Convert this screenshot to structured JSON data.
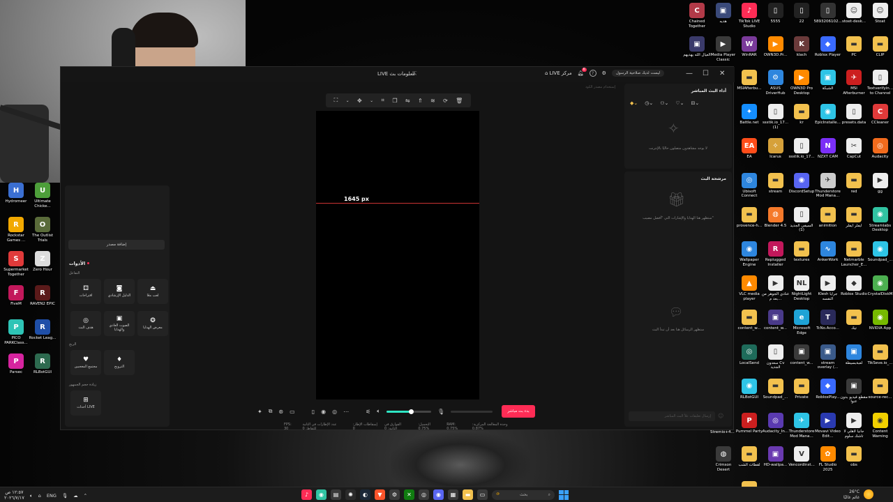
{
  "desktop_left_icons": [
    {
      "label": "Hydromeer",
      "color": "#3b6fd1",
      "glyph": "H"
    },
    {
      "label": "Ultimate Chicke...",
      "color": "#4d9e3a",
      "glyph": "U"
    },
    {
      "label": "Rockstar Games ...",
      "color": "#f2a900",
      "glyph": "R"
    },
    {
      "label": "The Outlist Trials",
      "color": "#5a6b3a",
      "glyph": "O"
    },
    {
      "label": "Supermarket Together",
      "color": "#e03a3a",
      "glyph": "S"
    },
    {
      "label": "Zero Hour",
      "color": "#dddddd",
      "glyph": "Z"
    },
    {
      "label": "FiveM",
      "color": "#c2185b",
      "glyph": "F"
    },
    {
      "label": "RAVEN2 EPIC",
      "color": "#5a1a1a",
      "glyph": "R"
    },
    {
      "label": "PICO PARKClass...",
      "color": "#2ec4b6",
      "glyph": "P"
    },
    {
      "label": "Rocket Leag...",
      "color": "#1f4fa8",
      "glyph": "R"
    },
    {
      "label": "Parsec",
      "color": "#d6249f",
      "glyph": "P"
    },
    {
      "label": "RLBotGUI",
      "color": "#2d6a4f",
      "glyph": "R"
    }
  ],
  "desktop_right_icons": [
    {
      "label": "Chained Together",
      "color": "#b23a48",
      "glyph": "C"
    },
    {
      "label": "هديه",
      "color": "#3a4a7a",
      "glyph": "▣"
    },
    {
      "label": "TikTok LIVE Studio",
      "color": "#fe2c55",
      "glyph": "♪"
    },
    {
      "label": "5555",
      "color": "#222222",
      "glyph": "▯"
    },
    {
      "label": "22",
      "color": "#222222",
      "glyph": "▯"
    },
    {
      "label": "5893206102...",
      "color": "#333333",
      "glyph": "▯"
    },
    {
      "label": "stoet-desk...",
      "color": "#eeeeee",
      "glyph": "☺"
    },
    {
      "label": "Stoat",
      "color": "#eeeeee",
      "glyph": "☺"
    },
    {
      "label": "العيال الله يهديهم",
      "color": "#3a3a6a",
      "glyph": "▣"
    },
    {
      "label": "Media Player Classic",
      "color": "#3a3a3a",
      "glyph": "▶"
    },
    {
      "label": "WinRAR",
      "color": "#7a3a9a",
      "glyph": "W"
    },
    {
      "label": "OWN3D.Pr...",
      "color": "#ff8a00",
      "glyph": "▶"
    },
    {
      "label": "klach",
      "color": "#6a3a3a",
      "glyph": "K"
    },
    {
      "label": "Roblox Player",
      "color": "#3a6aff",
      "glyph": "◆"
    },
    {
      "label": "PC",
      "color": "#f2c14e",
      "glyph": "▬"
    },
    {
      "label": "CLIP",
      "color": "#f2c14e",
      "glyph": "▬"
    },
    {
      "label": "MSIAfterbu...",
      "color": "#f2c14e",
      "glyph": "▬"
    },
    {
      "label": "ASUS DriverHub",
      "color": "#2e86de",
      "glyph": "⚙"
    },
    {
      "label": "OWN3D Pro Desktop",
      "color": "#ff8a00",
      "glyph": "▶"
    },
    {
      "label": "الشبكة",
      "color": "#2ec4e6",
      "glyph": "▣"
    },
    {
      "label": "MSI Afterburner",
      "color": "#cc1f1f",
      "glyph": "✈"
    },
    {
      "label": "Textverifyin... to Channel",
      "color": "#eeeeee",
      "glyph": "▯"
    },
    {
      "label": "Battle.net",
      "color": "#148eff",
      "glyph": "✦"
    },
    {
      "label": "ssstik.io_17... (1)",
      "color": "#eeeeee",
      "glyph": "▯"
    },
    {
      "label": "kr",
      "color": "#f2c14e",
      "glyph": "▬"
    },
    {
      "label": "EpicInstalle...",
      "color": "#2ec4e6",
      "glyph": "◉"
    },
    {
      "label": "presets.data",
      "color": "#eeeeee",
      "glyph": "▯"
    },
    {
      "label": "CCleaner",
      "color": "#e03a3a",
      "glyph": "C"
    },
    {
      "label": "EA",
      "color": "#ff4d1a",
      "glyph": "EA"
    },
    {
      "label": "Icarus",
      "color": "#d6a13a",
      "glyph": "✧"
    },
    {
      "label": "ssstik.io_17...",
      "color": "#eeeeee",
      "glyph": "▯"
    },
    {
      "label": "NZXT CAM",
      "color": "#7b2ff7",
      "glyph": "N"
    },
    {
      "label": "CapCut",
      "color": "#eeeeee",
      "glyph": "✂"
    },
    {
      "label": "Audacity",
      "color": "#f26b1d",
      "glyph": "◎"
    },
    {
      "label": "Ubisoft Connect",
      "color": "#2e86de",
      "glyph": "◎"
    },
    {
      "label": "stream",
      "color": "#f2c14e",
      "glyph": "▬"
    },
    {
      "label": "DiscordSetup",
      "color": "#5865f2",
      "glyph": "◉"
    },
    {
      "label": "Thunderstore Mod Mana...",
      "color": "#cccccc",
      "glyph": "✈"
    },
    {
      "label": "red",
      "color": "#f2c14e",
      "glyph": "▬"
    },
    {
      "label": "gg",
      "color": "#eeeeee",
      "glyph": "▶"
    },
    {
      "label": "provence-h...",
      "color": "#f2c14e",
      "glyph": "▬"
    },
    {
      "label": "Blender 4.5",
      "color": "#f5792a",
      "glyph": "◍"
    },
    {
      "label": "السيفي الجديد (1)",
      "color": "#eeeeee",
      "glyph": "▯"
    },
    {
      "label": "animition",
      "color": "#f2c14e",
      "glyph": "▬"
    },
    {
      "label": "ايفلر ايفلر",
      "color": "#f2c14e",
      "glyph": "▬"
    },
    {
      "label": "Streamlabs Desktop",
      "color": "#31c3a2",
      "glyph": "◉"
    },
    {
      "label": "Wallpaper Engine",
      "color": "#2e86de",
      "glyph": "◉"
    },
    {
      "label": "Replugged Installer",
      "color": "#c2185b",
      "glyph": "R"
    },
    {
      "label": "textures",
      "color": "#f2c14e",
      "glyph": "▬"
    },
    {
      "label": "AnkerWork",
      "color": "#2e86de",
      "glyph": "∿"
    },
    {
      "label": "Netmarble Launcher_E...",
      "color": "#f2c14e",
      "glyph": "▬"
    },
    {
      "label": "Soundpad_...",
      "color": "#2ec4e6",
      "glyph": "◉"
    },
    {
      "label": "VLC media player",
      "color": "#ff8a00",
      "glyph": "▲"
    },
    {
      "label": "عنادي الجوهر من بعد م...",
      "color": "#eeeeee",
      "glyph": "▶"
    },
    {
      "label": "NightLight Desktop",
      "color": "#eeeeee",
      "glyph": "NL"
    },
    {
      "label": "Klesh جرايا النقسه",
      "color": "#eeeeee",
      "glyph": "▶"
    },
    {
      "label": "Roblox Studio",
      "color": "#eeeeee",
      "glyph": "◆"
    },
    {
      "label": "CrystalDiskM",
      "color": "#4caf50",
      "glyph": "◉"
    },
    {
      "label": "content_w...",
      "color": "#f2c14e",
      "glyph": "▬"
    },
    {
      "label": "content_w...",
      "color": "#4a3a8a",
      "glyph": "▣"
    },
    {
      "label": "Microsoft Edge",
      "color": "#1fa3d6",
      "glyph": "e"
    },
    {
      "label": "TcNo.Acco...",
      "color": "#2a2a5a",
      "glyph": "T"
    },
    {
      "label": "تيك",
      "color": "#f2c14e",
      "glyph": "▬"
    },
    {
      "label": "NVIDIA App",
      "color": "#76b900",
      "glyph": "◉"
    },
    {
      "label": "LocalSend",
      "color": "#1e6b5a",
      "glyph": "◎"
    },
    {
      "label": "سعدون Cv الجديد",
      "color": "#eeeeee",
      "glyph": "▯"
    },
    {
      "label": "content_w...",
      "color": "#3a3a3a",
      "glyph": "▣"
    },
    {
      "label": "stream overlay (...",
      "color": "#3a5a8a",
      "glyph": "▣"
    },
    {
      "label": "لعبةبسيطة",
      "color": "#2e86de",
      "glyph": "▣"
    },
    {
      "label": "TikSeve.io_...",
      "color": "#f2c14e",
      "glyph": "▬"
    },
    {
      "label": "RLBotGUI",
      "color": "#2ec4e6",
      "glyph": "◉"
    },
    {
      "label": "Soundpad_...",
      "color": "#f2c14e",
      "glyph": "▬"
    },
    {
      "label": "Private",
      "color": "#f2c14e",
      "glyph": "▬"
    },
    {
      "label": "RobloxPlay...",
      "color": "#3a6aff",
      "glyph": "◆"
    },
    {
      "label": "مقطع فيديو بدون عنوا",
      "color": "#3a3a3a",
      "glyph": "▣"
    },
    {
      "label": "source-rec...",
      "color": "#f2c14e",
      "glyph": "▬"
    },
    {
      "label": "Pummel Party",
      "color": "#cc1f1f",
      "glyph": "P"
    },
    {
      "label": "Audacity_In...",
      "color": "#5a3ab0",
      "glyph": "◎"
    },
    {
      "label": "Thunderstore Mod Mana...",
      "color": "#2ec4e6",
      "glyph": "✈"
    },
    {
      "label": "Movavi Video Edit...",
      "color": "#2a3ab0",
      "glyph": "▶"
    },
    {
      "label": "جانيا لاهلي لا تاشك سلوم",
      "color": "#eeeeee",
      "glyph": "▶"
    },
    {
      "label": "Content Warning",
      "color": "#f2d000",
      "glyph": "◉"
    },
    {
      "label": "Crimson Desert",
      "color": "#3a3a3a",
      "glyph": "◍"
    },
    {
      "label": "لقطات الشب",
      "color": "#f2c14e",
      "glyph": "▬"
    },
    {
      "label": "HD-wallpa...",
      "color": "#6a3ab0",
      "glyph": "▣"
    },
    {
      "label": "VencordInst...",
      "color": "#eeeeee",
      "glyph": "V"
    },
    {
      "label": "FL Studio 2025",
      "color": "#ff8a00",
      "glyph": "✿"
    },
    {
      "label": "obs",
      "color": "#f2c14e",
      "glyph": "▬"
    },
    {
      "label": "red-car-wr...",
      "color": "#f2c14e",
      "glyph": "▬"
    }
  ],
  "stremio_label": "Stremio+4...",
  "app": {
    "title": "LIVE معلومات بث",
    "header_buttons": {
      "live_center": "LIVE مركز",
      "notification_count": "6",
      "account": "ليست لديك صلاحية الرسول"
    },
    "dimension_hint": "إستخدام مصدر الكود",
    "canvas": {
      "measure_label": "1645 px"
    },
    "left_panel": {
      "add_source": "إضافة مصدر",
      "tools_title": "الأدوات",
      "section_interaction": "التفاعل",
      "section_earn": "الربح",
      "section_audience": "زيادة حجم الجمهور",
      "tools": [
        {
          "icon": "⚃",
          "label": "اقتراحات",
          "name": "suggestions"
        },
        {
          "icon": "◙",
          "label": "الدليل الإرشادي",
          "name": "guide"
        },
        {
          "icon": "⏏",
          "label": "لعب معًا",
          "name": "play-together"
        },
        {
          "icon": "◎",
          "label": "هدف البث",
          "name": "stream-goal"
        },
        {
          "icon": "▣",
          "label": "الصوت العادي والهدايا",
          "name": "sound-gifts"
        },
        {
          "icon": "❂",
          "label": "معرض الهدايا",
          "name": "gift-gallery"
        },
        {
          "icon": "♥",
          "label": "مجتمع المعجبين",
          "name": "fan-club"
        },
        {
          "icon": "♦",
          "label": "الترويج",
          "name": "promotion"
        },
        {
          "icon": "⊞",
          "label": "أحداث LIVE",
          "name": "live-events"
        }
      ]
    },
    "controls": {
      "go_live_label": "بدء بث مباشر",
      "volume_percent": 55
    },
    "stats": [
      "FPS: 30",
      "عدد الإطارات في الثانية للتقاط: 0",
      "إسقاطات الإطار: 0",
      "الفوارق في الثانية: 0",
      "التحميل: 0.75%",
      "RAM: 0.75%",
      "وحدة المعالجة المركزية: 0.87%"
    ],
    "right_panel": {
      "live_performance_title": "أداء البث المباشر",
      "no_viewers_text": "لا يوجد مشاهدون متصلون حاليًا بالإنترنت",
      "gift_panel_title": "مرشحة البث",
      "gift_empty_text": "ستظهر هنا الهدايا والإشارات التي \"أفضل مصيب\"",
      "chat_empty_text": "ستظهر الرسائل هنا بعد أن تبدأ البث",
      "chat_placeholder": "إرسال تعليقات علاً البث المباشر"
    }
  },
  "taskbar": {
    "time": "١٢:٥٧ ص",
    "date": "٢٠٢٦/٧/١٧",
    "lang": "ENG",
    "search_placeholder": "بحث",
    "weather_temp": "26°C",
    "weather_desc": "غائم غالبًا"
  }
}
